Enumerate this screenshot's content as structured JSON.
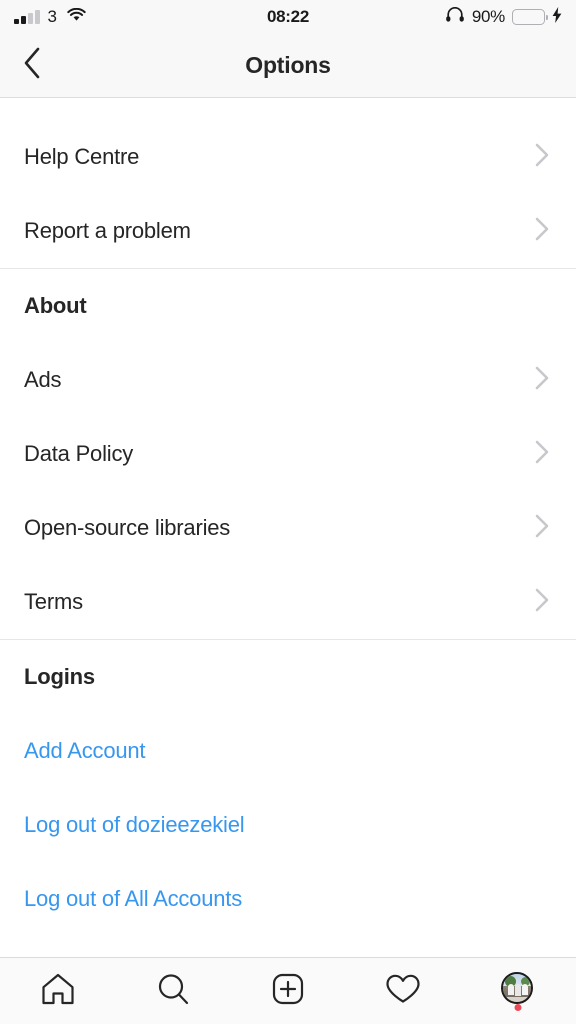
{
  "status_bar": {
    "carrier": "3",
    "signal_bars_filled": 2,
    "signal_bars_total": 4,
    "wifi_icon": "wifi-icon",
    "time": "08:22",
    "headphones_icon": "headphones-icon",
    "battery_percent": "90%",
    "battery_level": 90,
    "battery_color": "#4cd964",
    "charging_icon": "lightning-bolt-icon"
  },
  "nav": {
    "back_icon": "chevron-left-icon",
    "title": "Options"
  },
  "colors": {
    "link_blue": "#3797ef",
    "text_primary": "#262626",
    "chevron_gray": "#c7c7cc",
    "divider": "#e6e6e6",
    "notification_red": "#ed4956"
  },
  "sections": [
    {
      "header": null,
      "rows": [
        {
          "label": "Help Centre",
          "accessory": "chevron-right-icon"
        },
        {
          "label": "Report a problem",
          "accessory": "chevron-right-icon"
        }
      ]
    },
    {
      "header": "About",
      "rows": [
        {
          "label": "Ads",
          "accessory": "chevron-right-icon"
        },
        {
          "label": "Data Policy",
          "accessory": "chevron-right-icon"
        },
        {
          "label": "Open-source libraries",
          "accessory": "chevron-right-icon"
        },
        {
          "label": "Terms",
          "accessory": "chevron-right-icon"
        }
      ]
    },
    {
      "header": "Logins",
      "links": [
        {
          "label": "Add Account"
        },
        {
          "label": "Log out of dozieezekiel"
        },
        {
          "label": "Log out of All Accounts"
        }
      ]
    }
  ],
  "tabbar": {
    "tabs": [
      {
        "icon": "home-icon",
        "label": "Home"
      },
      {
        "icon": "search-icon",
        "label": "Search"
      },
      {
        "icon": "add-post-icon",
        "label": "New Post"
      },
      {
        "icon": "heart-icon",
        "label": "Activity"
      },
      {
        "icon": "profile-avatar",
        "label": "Profile",
        "badge": true
      }
    ]
  }
}
